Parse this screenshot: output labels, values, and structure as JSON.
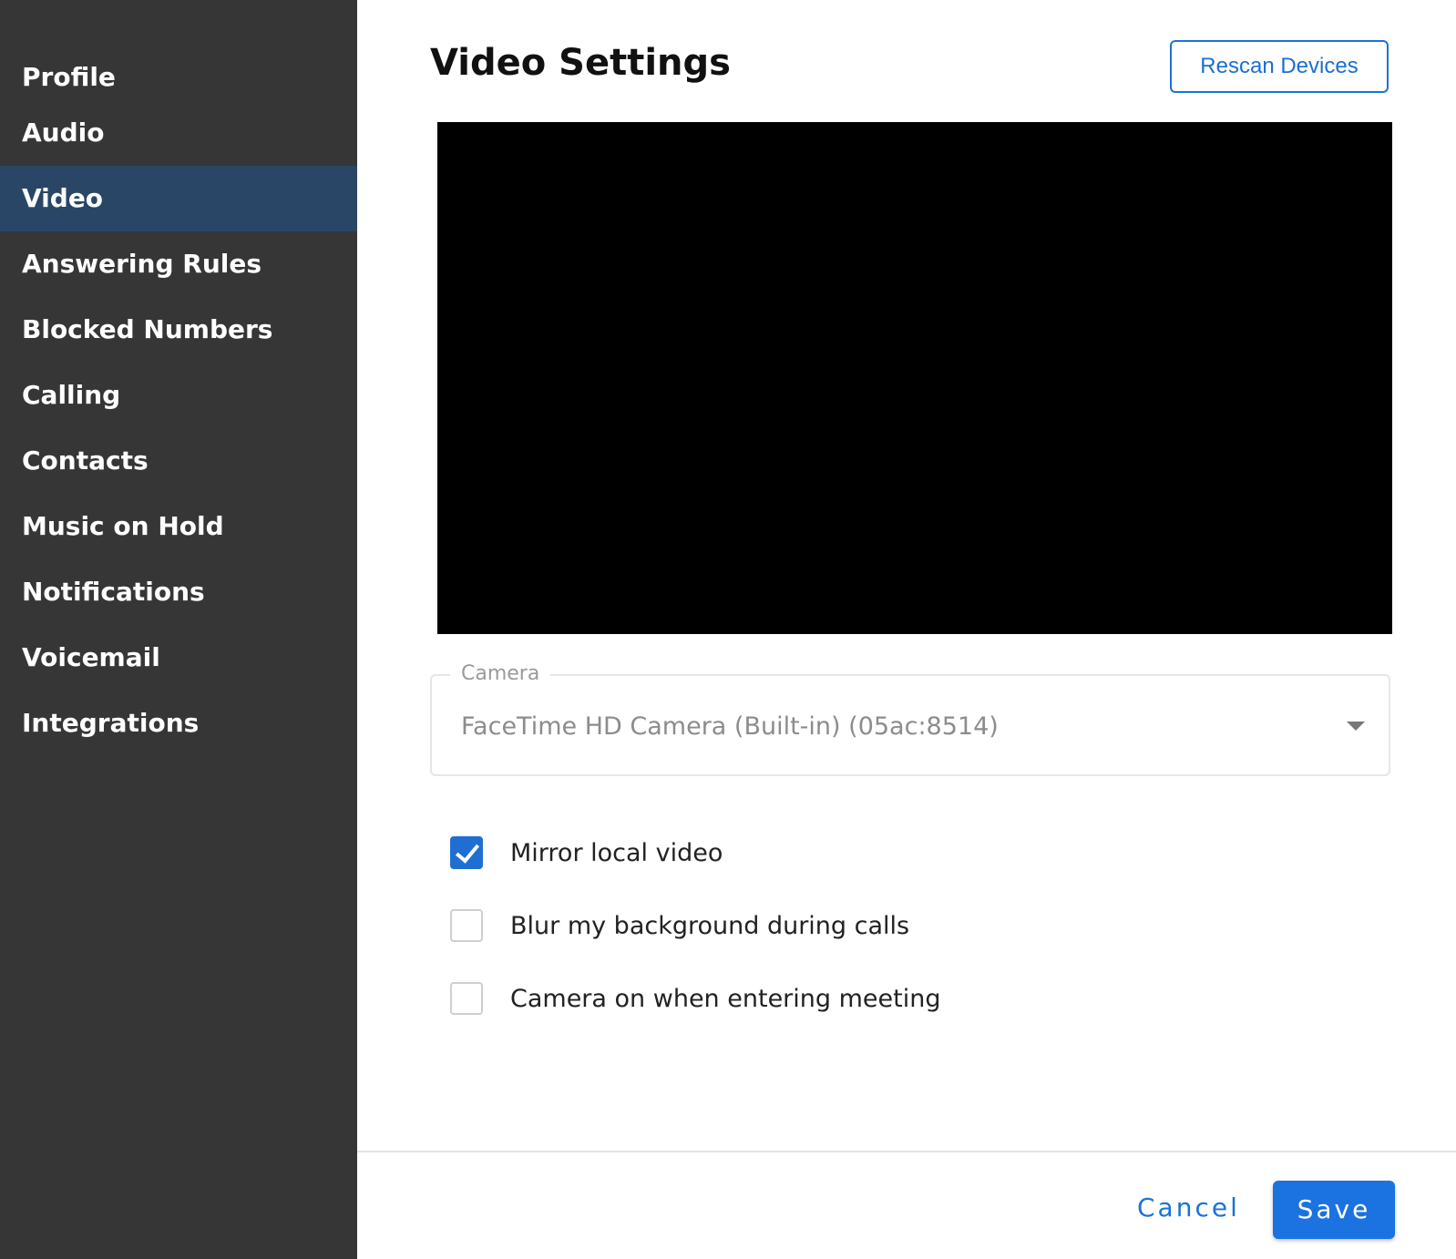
{
  "sidebar": {
    "items": [
      {
        "label": "Profile",
        "active": false
      },
      {
        "label": "Audio",
        "active": false
      },
      {
        "label": "Video",
        "active": true
      },
      {
        "label": "Answering Rules",
        "active": false
      },
      {
        "label": "Blocked Numbers",
        "active": false
      },
      {
        "label": "Calling",
        "active": false
      },
      {
        "label": "Contacts",
        "active": false
      },
      {
        "label": "Music on Hold",
        "active": false
      },
      {
        "label": "Notifications",
        "active": false
      },
      {
        "label": "Voicemail",
        "active": false
      },
      {
        "label": "Integrations",
        "active": false
      }
    ]
  },
  "main": {
    "title": "Video Settings",
    "rescan_label": "Rescan Devices",
    "camera": {
      "legend": "Camera",
      "selected": "FaceTime HD Camera (Built-in) (05ac:8514)"
    },
    "options": [
      {
        "label": "Mirror local video",
        "checked": true
      },
      {
        "label": "Blur my background during calls",
        "checked": false
      },
      {
        "label": "Camera on when entering meeting",
        "checked": false
      }
    ]
  },
  "footer": {
    "cancel_label": "Cancel",
    "save_label": "Save"
  },
  "colors": {
    "sidebar_bg": "#363636",
    "sidebar_active_bg": "#294666",
    "accent": "#1a73e0"
  }
}
